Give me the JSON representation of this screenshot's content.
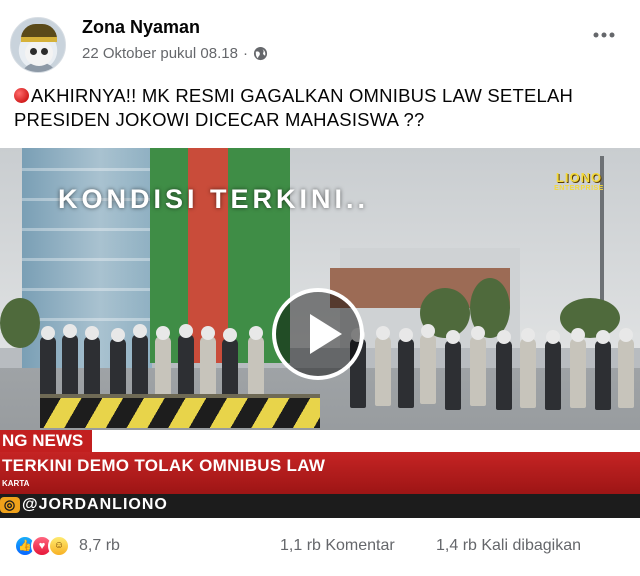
{
  "post": {
    "page_name": "Zona Nyaman",
    "timestamp": "22 Oktober pukul 08.18",
    "separator": "·",
    "privacy_icon": "globe-icon",
    "more_icon": "more-horizontal-icon",
    "caption": "AKHIRNYA!! MK RESMI GAGALKAN OMNIBUS LAW SETELAH PRESIDEN JOKOWI DICECAR MAHASISWA ??",
    "caption_emoji": "red-circle-emoji"
  },
  "video": {
    "overlay_title": "KONDISI TERKINI..",
    "logo_main": "LIONO",
    "logo_sub": "ENTERPRISE",
    "news_label": "NG NEWS",
    "headline": "TERKINI DEMO TOLAK OMNIBUS LAW",
    "sub_location": "KARTA",
    "handle": "@JORDANLIONO",
    "play_icon": "play-icon"
  },
  "footer": {
    "reactions": [
      "like",
      "love",
      "haha"
    ],
    "reaction_count": "8,7 rb",
    "comments": "1,1 rb Komentar",
    "shares": "1,4 rb Kali dibagikan"
  },
  "colors": {
    "text_primary": "#050505",
    "text_secondary": "#65676b",
    "news_red": "#c21f1f",
    "like_blue": "#0866ff",
    "love_red": "#e61739",
    "haha_yellow": "#f7b125"
  }
}
